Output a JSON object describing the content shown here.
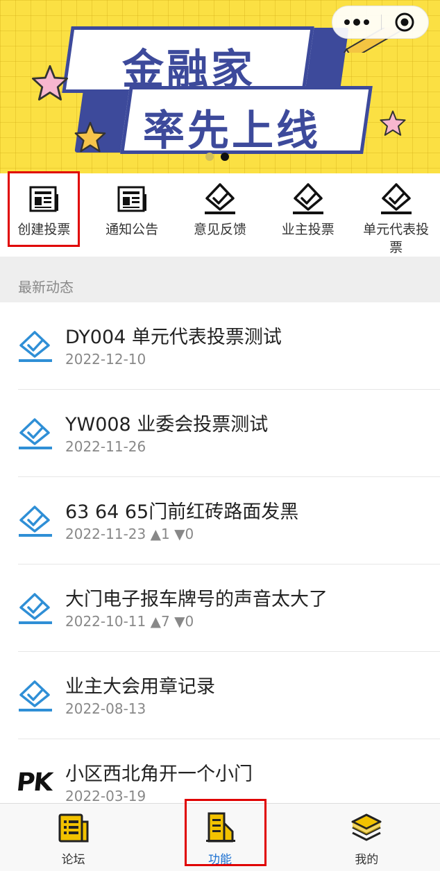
{
  "banner": {
    "line1": "金融家",
    "line2": "率先上线",
    "pagination_total": 2,
    "pagination_active": 2,
    "background_color": "#fbe043",
    "accent_color": "#3d4a9b"
  },
  "capsule": {
    "more_icon": "more-dots-icon",
    "close_icon": "target-close-icon"
  },
  "functions": [
    {
      "label": "创建投票",
      "icon": "newspaper-icon"
    },
    {
      "label": "通知公告",
      "icon": "newspaper-icon"
    },
    {
      "label": "意见反馈",
      "icon": "vote-check-icon"
    },
    {
      "label": "业主投票",
      "icon": "vote-check-icon"
    },
    {
      "label": "单元代表投票",
      "icon": "vote-check-icon"
    }
  ],
  "section": {
    "title": "最新动态"
  },
  "news": [
    {
      "title": "DY004 单元代表投票测试",
      "date": "2022-12-10",
      "icon": "vote-check-icon"
    },
    {
      "title": "YW008 业委会投票测试",
      "date": "2022-11-26",
      "icon": "vote-check-icon"
    },
    {
      "title": "63 64 65门前红砖路面发黑",
      "date": "2022-11-23",
      "up": "▲1",
      "down": "▼0",
      "icon": "vote-check-icon"
    },
    {
      "title": "大门电子报车牌号的声音太大了",
      "date": "2022-10-11",
      "up": "▲7",
      "down": "▼0",
      "icon": "vote-check-icon"
    },
    {
      "title": "业主大会用章记录",
      "date": "2022-08-13",
      "icon": "vote-check-icon"
    },
    {
      "title": "小区西北角开一个小门",
      "date": "2022-03-19",
      "icon": "pk-icon",
      "icon_text": "PK"
    }
  ],
  "tabs": [
    {
      "label": "论坛",
      "icon": "forum-list-icon"
    },
    {
      "label": "功能",
      "icon": "building-icon",
      "active": true
    },
    {
      "label": "我的",
      "icon": "layers-icon"
    }
  ],
  "colors": {
    "list_icon": "#2f8fd6",
    "active_tab": "#1a6fd1",
    "tab_icon_fill": "#f2c200",
    "highlight": "#e00000"
  }
}
